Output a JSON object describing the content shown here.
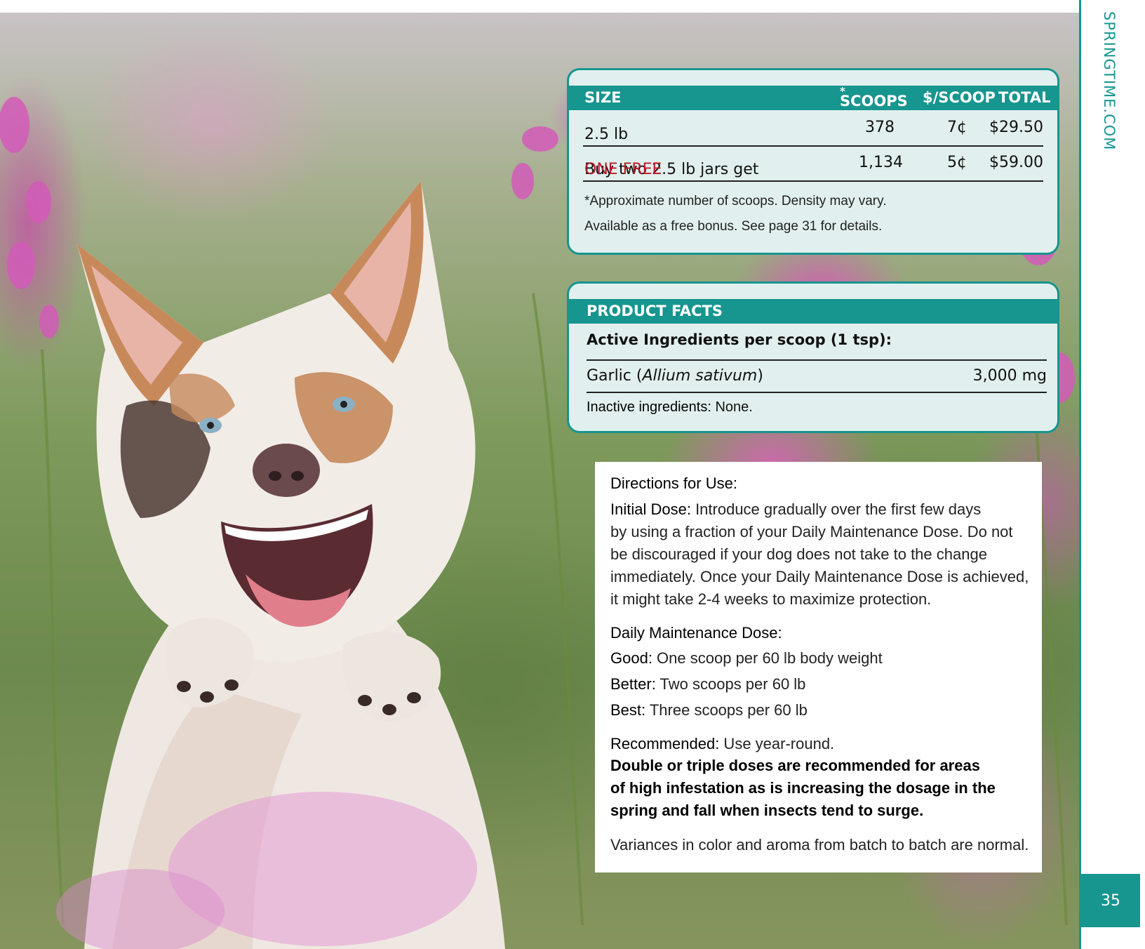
{
  "sidebar": {
    "url": "SPRINGTIME.COM",
    "page_number": "35"
  },
  "colors": {
    "teal": "#17958f",
    "panel_bg": "#e1f0ee",
    "red_highlight": "#b81b26"
  },
  "pricing": {
    "headers": {
      "size": "SIZE",
      "scoops": "SCOOPS",
      "scoops_mark": "*",
      "per_scoop": "$/SCOOP",
      "total": "TOTAL"
    },
    "rows": [
      {
        "size": "2.5 lb",
        "size_highlight": "",
        "scoops": "378",
        "per_scoop": "7¢",
        "total": "$29.50"
      },
      {
        "size": "Buy two 2.5 lb jars get ",
        "size_highlight": "ONE FREE",
        "scoops": "1,134",
        "per_scoop": "5¢",
        "total": "$59.00"
      }
    ],
    "notes": [
      "*Approximate number of scoops. Density may vary.",
      "Available as a free bonus. See page 31 for details."
    ]
  },
  "facts": {
    "header": "PRODUCT FACTS",
    "active_heading": "Active Ingredients per scoop (1 tsp):",
    "ingredient": {
      "name": "Garlic (",
      "latin": "Allium sativum",
      "close": ")",
      "amount": "3,000 mg"
    },
    "inactive_label": "Inactive ingredients:",
    "inactive_value": " None."
  },
  "directions": {
    "title": "Directions for Use:",
    "initial_label": "Initial Dose:",
    "initial_lines": [
      " Introduce gradually over the first few days",
      "by using a fraction of your Daily Maintenance Dose. Do not",
      "be discouraged if your dog does not take to the change",
      "immediately. Once your Daily Maintenance Dose is achieved,",
      "it might take 2-4 weeks to maximize protection."
    ],
    "maintenance_title": "Daily Maintenance Dose:",
    "doses": [
      {
        "label": "Good:",
        "text": " One scoop per 60 lb body weight"
      },
      {
        "label": "Better:",
        "text": " Two scoops per 60 lb"
      },
      {
        "label": "Best:",
        "text": " Three scoops per 60 lb"
      }
    ],
    "recommended_label": "Recommended:",
    "recommended_text": " Use year-round.",
    "emphasis_lines": [
      "Double or triple doses are recommended for areas",
      "of high infestation as is increasing the dosage in the",
      "spring and fall when insects tend to surge."
    ],
    "variance": "Variances in color and aroma from batch to batch are normal."
  }
}
